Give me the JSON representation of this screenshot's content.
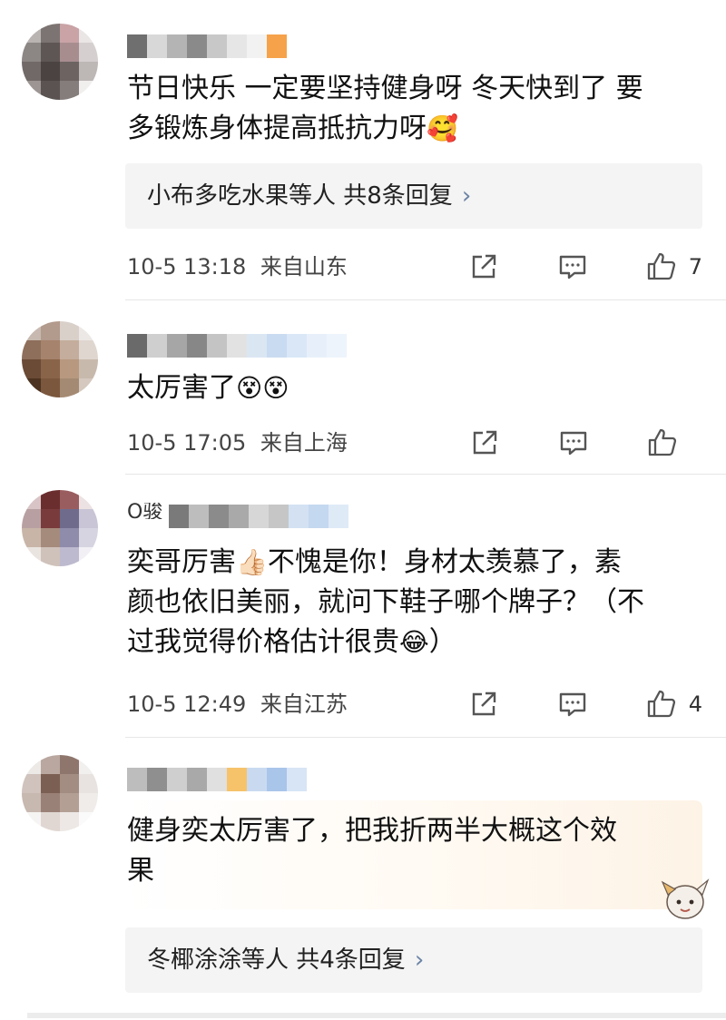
{
  "comments": [
    {
      "text_line1": "节日快乐  一定要坚持健身呀 冬天快到了 要",
      "text_line2": "多锻炼身体提高抵抗力呀",
      "emoji": "🥰",
      "replies": "小布多吃水果等人  共8条回复",
      "time": "10-5 13:18",
      "location": "来自山东",
      "likes": "7"
    },
    {
      "text_line1": "太厉害了",
      "emoji": "😵😵",
      "time": "10-5 17:05",
      "location": "来自上海",
      "likes": ""
    },
    {
      "username_partial": "O骏",
      "text_line1": "奕哥厉害",
      "emoji_thumb": "👍🏻",
      "text_line1b": "不愧是你！身材太羡慕了，素",
      "text_line2": "颜也依旧美丽，就问下鞋子哪个牌子？（不",
      "text_line3": "过我觉得价格估计很贵",
      "emoji_laugh": "😂",
      "text_line3b": "）",
      "time": "10-5 12:49",
      "location": "来自江苏",
      "likes": "4"
    },
    {
      "text_line1": "健身奕太厉害了，把我折两半大概这个效",
      "text_line2": "果",
      "replies": "冬椰涂涂等人  共4条回复"
    }
  ],
  "icons": {
    "share": "share-icon",
    "comment": "comment-icon",
    "like": "thumbs-up-icon",
    "chevron": "chevron-right-icon"
  },
  "colors": {
    "chevron": "#6b83a6",
    "reply_bg": "#f4f4f4",
    "highlight": "#fdf3e6"
  }
}
